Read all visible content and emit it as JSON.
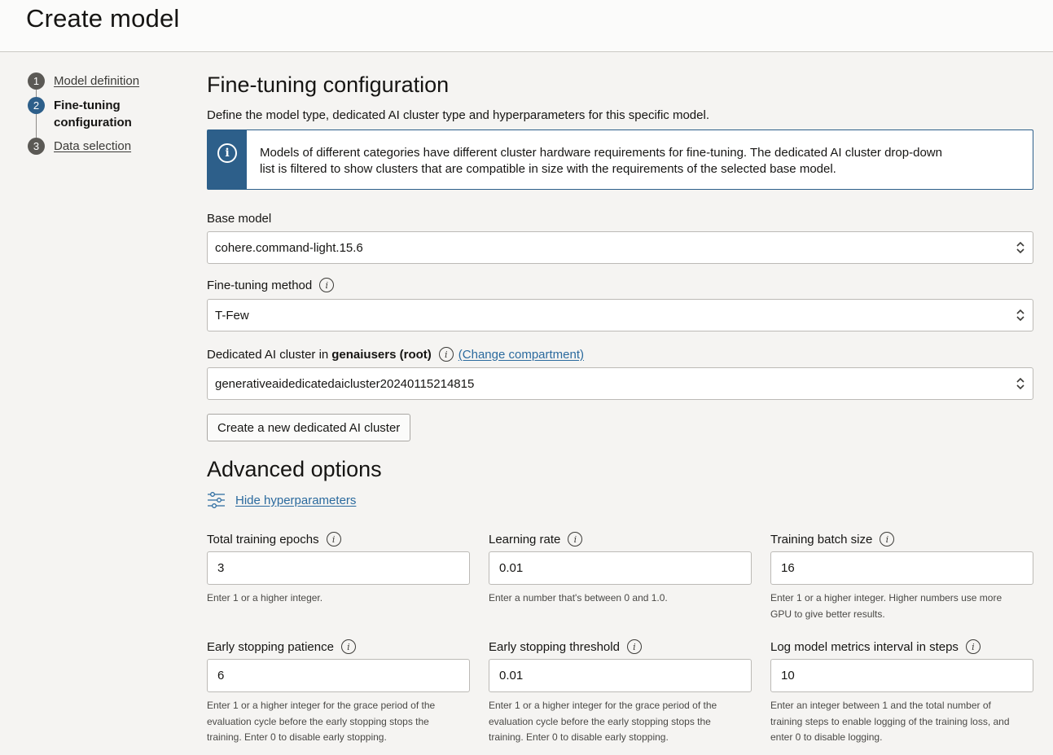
{
  "page_title": "Create model",
  "steps": [
    {
      "num": "1",
      "label": "Model definition"
    },
    {
      "num": "2",
      "label_line1": "Fine-tuning",
      "label_line2": "configuration"
    },
    {
      "num": "3",
      "label": "Data selection"
    }
  ],
  "section": {
    "title": "Fine-tuning configuration",
    "description": "Define the model type, dedicated AI cluster type and hyperparameters for this specific model."
  },
  "info": {
    "line1": "Models of different categories have different cluster hardware requirements for fine-tuning. The dedicated AI cluster drop-down",
    "line2": "list is filtered to show clusters that are compatible in size with the requirements of the selected base model."
  },
  "base_model": {
    "label": "Base model",
    "value": "cohere.command-light.15.6"
  },
  "method": {
    "label": "Fine-tuning method",
    "value": "T-Few"
  },
  "cluster": {
    "label_prefix": "Dedicated AI cluster in",
    "compartment": "genaiusers (root)",
    "change_link": "(Change compartment)",
    "value": "generativeaidedicatedaicluster20240115214815"
  },
  "create_cluster_button": "Create a new dedicated AI cluster",
  "advanced": {
    "title": "Advanced options",
    "toggle_label": "Hide hyperparameters"
  },
  "hyperparameters": [
    {
      "label": "Total training epochs",
      "value": "3",
      "help_lines": [
        "Enter 1 or a higher integer."
      ]
    },
    {
      "label": "Learning rate",
      "value": "0.01",
      "help_lines": [
        "Enter a number that's between 0 and 1.0."
      ]
    },
    {
      "label": "Training batch size",
      "value": "16",
      "help_lines": [
        "Enter 1 or a higher integer. Higher numbers use more",
        "GPU to give better results."
      ]
    },
    {
      "label": "Early stopping patience",
      "value": "6",
      "help_lines": [
        "Enter 1 or a higher integer for the grace period of the",
        "evaluation cycle before the early stopping stops the",
        "training. Enter 0 to disable early stopping."
      ]
    },
    {
      "label": "Early stopping threshold",
      "value": "0.01",
      "help_lines": [
        "Enter 1 or a higher integer for the grace period of the",
        "evaluation cycle before the early stopping stops the",
        "training. Enter 0 to disable early stopping."
      ]
    },
    {
      "label": "Log model metrics interval in steps",
      "value": "10",
      "help_lines": [
        "Enter an integer between 1 and the total number of",
        "training steps to enable logging of the training loss, and",
        "enter 0 to disable logging."
      ]
    }
  ]
}
